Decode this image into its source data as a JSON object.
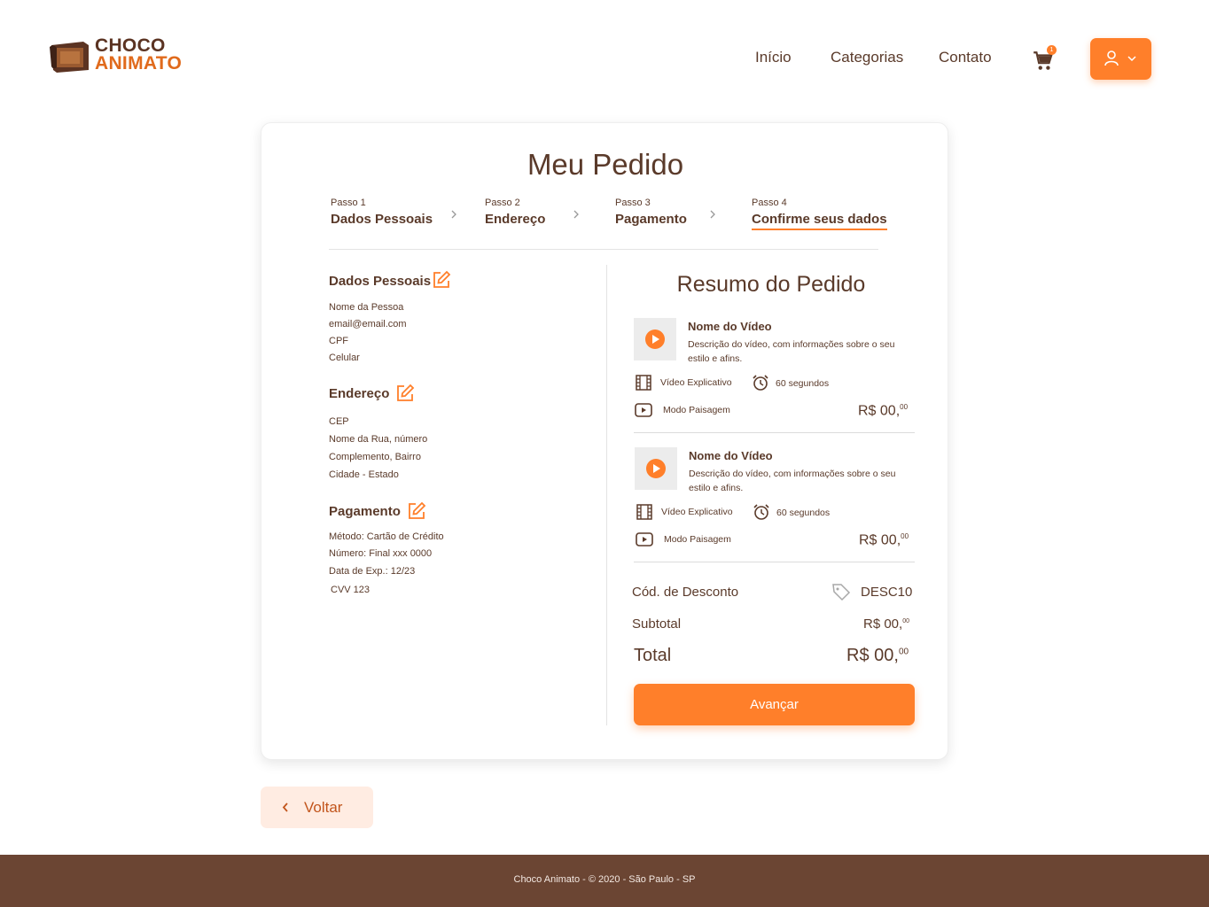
{
  "brand": {
    "line1": "CHOCO",
    "line2": "ANIMATO"
  },
  "nav": {
    "inicio": "Início",
    "categorias": "Categorias",
    "contato": "Contato",
    "cart_count": "1"
  },
  "page": {
    "title": "Meu Pedido"
  },
  "steps": [
    {
      "num": "Passo 1",
      "label": "Dados Pessoais"
    },
    {
      "num": "Passo 2",
      "label": "Endereço"
    },
    {
      "num": "Passo 3",
      "label": "Pagamento"
    },
    {
      "num": "Passo 4",
      "label": "Confirme seus dados"
    }
  ],
  "dados": {
    "title": "Dados Pessoais",
    "lines": [
      "Nome da Pessoa",
      "email@email.com",
      "CPF",
      "Celular"
    ]
  },
  "endereco": {
    "title": "Endereço",
    "lines": [
      "CEP",
      "Nome da Rua, número",
      "Complemento, Bairro",
      "Cidade - Estado"
    ]
  },
  "pagamento": {
    "title": "Pagamento",
    "lines": [
      "Método: Cartão de Crédito",
      "Número: Final xxx 0000",
      "Data de Exp.: 12/23",
      "CVV 123"
    ]
  },
  "resumo": {
    "title": "Resumo do Pedido",
    "items": [
      {
        "name": "Nome do Vídeo",
        "desc": "Descrição do vídeo, com informações sobre o seu estilo e afins.",
        "type": "Vídeo Explicativo",
        "duration": "60 segundos",
        "mode": "Modo Paisagem",
        "price": "R$ 00,",
        "cents": "00"
      },
      {
        "name": "Nome do Vídeo",
        "desc": "Descrição do vídeo, com informações sobre o seu estilo e afins.",
        "type": "Vídeo Explicativo",
        "duration": "60 segundos",
        "mode": "Modo Paisagem",
        "price": "R$ 00,",
        "cents": "00"
      }
    ],
    "discount_label": "Cód. de Desconto",
    "discount_code": "DESC10",
    "subtotal_label": "Subtotal",
    "subtotal_value": "R$ 00,",
    "subtotal_cents": "00",
    "total_label": "Total",
    "total_value": "R$ 00,",
    "total_cents": "00",
    "advance_label": "Avançar"
  },
  "back_label": "Voltar",
  "footer": "Choco Animato - © 2020 - São Paulo - SP",
  "colors": {
    "accent": "#ff7f2a",
    "brown": "#5a3a2a",
    "footer": "#6b4533"
  }
}
